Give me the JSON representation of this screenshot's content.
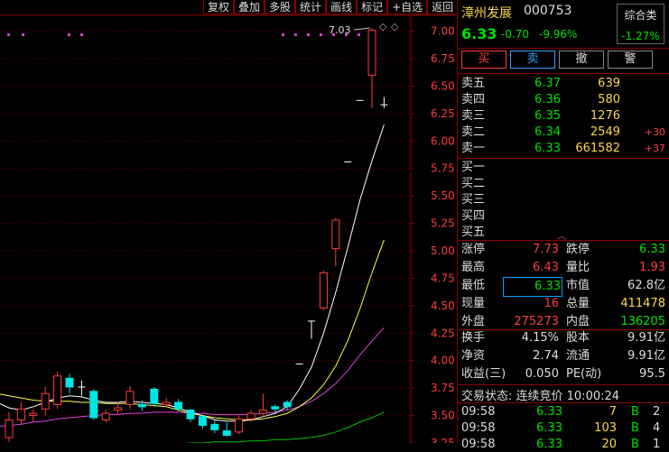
{
  "toolbar": [
    "复权",
    "叠加",
    "多股",
    "统计",
    "画线",
    "标记",
    "+自选",
    "返回"
  ],
  "chart_data": {
    "type": "candlestick",
    "y_ticks": [
      "7.00",
      "6.75",
      "6.50",
      "6.25",
      "6.00",
      "5.75",
      "5.50",
      "5.25",
      "5.00",
      "4.75",
      "4.50",
      "4.25",
      "4.00",
      "3.75",
      "3.50",
      "3.25"
    ],
    "ylim": [
      3.25,
      7.12
    ],
    "high_label": "7.03",
    "candles": [
      {
        "o": 3.3,
        "c": 3.46,
        "h": 3.53,
        "l": 3.26
      },
      {
        "o": 3.46,
        "c": 3.56,
        "h": 3.62,
        "l": 3.42
      },
      {
        "o": 3.5,
        "c": 3.52,
        "h": 3.56,
        "l": 3.44
      },
      {
        "o": 3.56,
        "c": 3.7,
        "h": 3.76,
        "l": 3.5
      },
      {
        "o": 3.6,
        "c": 3.86,
        "h": 3.9,
        "l": 3.56
      },
      {
        "o": 3.84,
        "c": 3.76,
        "h": 3.88,
        "l": 3.7
      },
      {
        "o": 3.76,
        "c": 3.76,
        "h": 3.82,
        "l": 3.68
      },
      {
        "o": 3.72,
        "c": 3.48,
        "h": 3.74,
        "l": 3.46
      },
      {
        "o": 3.46,
        "c": 3.52,
        "h": 3.55,
        "l": 3.44
      },
      {
        "o": 3.55,
        "c": 3.57,
        "h": 3.62,
        "l": 3.52
      },
      {
        "o": 3.6,
        "c": 3.72,
        "h": 3.77,
        "l": 3.56
      },
      {
        "o": 3.6,
        "c": 3.58,
        "h": 3.64,
        "l": 3.54
      },
      {
        "o": 3.74,
        "c": 3.61,
        "h": 3.76,
        "l": 3.58
      },
      {
        "o": 3.6,
        "c": 3.62,
        "h": 3.66,
        "l": 3.58
      },
      {
        "o": 3.62,
        "c": 3.56,
        "h": 3.65,
        "l": 3.54
      },
      {
        "o": 3.55,
        "c": 3.47,
        "h": 3.56,
        "l": 3.44
      },
      {
        "o": 3.49,
        "c": 3.41,
        "h": 3.5,
        "l": 3.38
      },
      {
        "o": 3.42,
        "c": 3.37,
        "h": 3.46,
        "l": 3.34
      },
      {
        "o": 3.36,
        "c": 3.32,
        "h": 3.44,
        "l": 3.31
      },
      {
        "o": 3.35,
        "c": 3.47,
        "h": 3.5,
        "l": 3.33
      },
      {
        "o": 3.47,
        "c": 3.52,
        "h": 3.55,
        "l": 3.44
      },
      {
        "o": 3.52,
        "c": 3.55,
        "h": 3.7,
        "l": 3.5
      },
      {
        "o": 3.58,
        "c": 3.56,
        "h": 3.6,
        "l": 3.52
      },
      {
        "o": 3.62,
        "c": 3.58,
        "h": 3.64,
        "l": 3.55
      },
      {
        "o": 3.97,
        "c": 3.97,
        "h": 3.97,
        "l": 3.97
      },
      {
        "o": 4.36,
        "c": 4.36,
        "h": 4.36,
        "l": 4.2
      },
      {
        "o": 4.48,
        "c": 4.8,
        "h": 4.82,
        "l": 4.46
      },
      {
        "o": 5.02,
        "c": 5.28,
        "h": 5.3,
        "l": 4.86
      },
      {
        "o": 5.81,
        "c": 5.81,
        "h": 5.81,
        "l": 5.81
      },
      {
        "o": 6.37,
        "c": 6.37,
        "h": 6.37,
        "l": 6.37
      },
      {
        "o": 6.6,
        "c": 7.01,
        "h": 7.03,
        "l": 6.3
      },
      {
        "o": 6.33,
        "c": 6.33,
        "h": 6.4,
        "l": 6.3
      }
    ],
    "ma_white": [
      3.62,
      3.57,
      3.55,
      3.58,
      3.62,
      3.66,
      3.68,
      3.67,
      3.64,
      3.62,
      3.62,
      3.63,
      3.62,
      3.61,
      3.6,
      3.57,
      3.53,
      3.5,
      3.46,
      3.45,
      3.45,
      3.46,
      3.49,
      3.52,
      3.58,
      3.74,
      3.94,
      4.25,
      4.62,
      5.03,
      5.46,
      5.82,
      6.15
    ],
    "ma_yellow": [
      3.7,
      3.68,
      3.66,
      3.64,
      3.63,
      3.63,
      3.63,
      3.62,
      3.62,
      3.61,
      3.61,
      3.61,
      3.6,
      3.59,
      3.58,
      3.55,
      3.52,
      3.5,
      3.48,
      3.47,
      3.46,
      3.46,
      3.47,
      3.49,
      3.52,
      3.58,
      3.66,
      3.78,
      3.95,
      4.18,
      4.47,
      4.8,
      5.1
    ],
    "ma_magenta": [
      3.4,
      3.41,
      3.42,
      3.44,
      3.45,
      3.47,
      3.48,
      3.49,
      3.5,
      3.51,
      3.51,
      3.52,
      3.52,
      3.53,
      3.53,
      3.53,
      3.52,
      3.52,
      3.51,
      3.51,
      3.51,
      3.51,
      3.52,
      3.53,
      3.55,
      3.58,
      3.63,
      3.7,
      3.79,
      3.91,
      4.05,
      4.18,
      4.3
    ],
    "ma_green": [
      3.1,
      3.11,
      3.12,
      3.13,
      3.14,
      3.15,
      3.16,
      3.17,
      3.18,
      3.19,
      3.2,
      3.21,
      3.22,
      3.23,
      3.24,
      3.24,
      3.25,
      3.25,
      3.26,
      3.26,
      3.26,
      3.27,
      3.27,
      3.28,
      3.28,
      3.29,
      3.3,
      3.32,
      3.35,
      3.39,
      3.44,
      3.48,
      3.53
    ]
  },
  "quote": {
    "name": "漳州发展",
    "code": "000753",
    "price": "6.33",
    "change": "-0.70",
    "pct": "-9.96%",
    "sector_name": "综合类",
    "sector_pct": "-1.27%"
  },
  "buttons": [
    "买",
    "卖",
    "撤",
    "警"
  ],
  "asks": [
    {
      "label": "卖五",
      "price": "6.37",
      "vol": "639",
      "delta": ""
    },
    {
      "label": "卖四",
      "price": "6.36",
      "vol": "580",
      "delta": ""
    },
    {
      "label": "卖三",
      "price": "6.35",
      "vol": "1276",
      "delta": ""
    },
    {
      "label": "卖二",
      "price": "6.34",
      "vol": "2549",
      "delta": "+30"
    },
    {
      "label": "卖一",
      "price": "6.33",
      "vol": "661582",
      "delta": "+37"
    }
  ],
  "bids": [
    "买一",
    "买二",
    "买三",
    "买四",
    "买五"
  ],
  "stats": [
    {
      "l": "涨停",
      "v": "7.73",
      "vc": "red",
      "l2": "跌停",
      "v2": "6.33",
      "v2c": "green"
    },
    {
      "l": "最高",
      "v": "6.43",
      "vc": "red",
      "l2": "量比",
      "v2": "1.93",
      "v2c": "red"
    },
    {
      "l": "最低",
      "v": "6.33",
      "vc": "green boxed",
      "l2": "市值",
      "v2": "62.8亿",
      "v2c": "white"
    },
    {
      "l": "现量",
      "v": "16",
      "vc": "red",
      "l2": "总量",
      "v2": "411478",
      "v2c": "yellow"
    },
    {
      "l": "外盘",
      "v": "275273",
      "vc": "red",
      "l2": "内盘",
      "v2": "136205",
      "v2c": "green"
    }
  ],
  "stats2": [
    {
      "l": "换手",
      "v": "4.15%",
      "vc": "white",
      "l2": "股本",
      "v2": "9.91亿",
      "v2c": "white"
    },
    {
      "l": "净资",
      "v": "2.74",
      "vc": "white",
      "l2": "流通",
      "v2": "9.91亿",
      "v2c": "white"
    },
    {
      "l": "收益(三)",
      "v": "0.050",
      "vc": "white",
      "l2": "PE(动)",
      "v2": "95.5",
      "v2c": "white"
    }
  ],
  "status": "交易状态: 连续竞价 10:00:24",
  "ticks": [
    {
      "t": "09:58",
      "p": "6.33",
      "v": "7",
      "s": "B",
      "n": "2"
    },
    {
      "t": "09:58",
      "p": "6.33",
      "v": "103",
      "s": "B",
      "n": "4"
    },
    {
      "t": "09:58",
      "p": "6.33",
      "v": "20",
      "s": "B",
      "n": "1"
    }
  ],
  "colors": {
    "up": "#ff3c3c",
    "down": "#00e5e5",
    "frame": "#8a0000"
  }
}
